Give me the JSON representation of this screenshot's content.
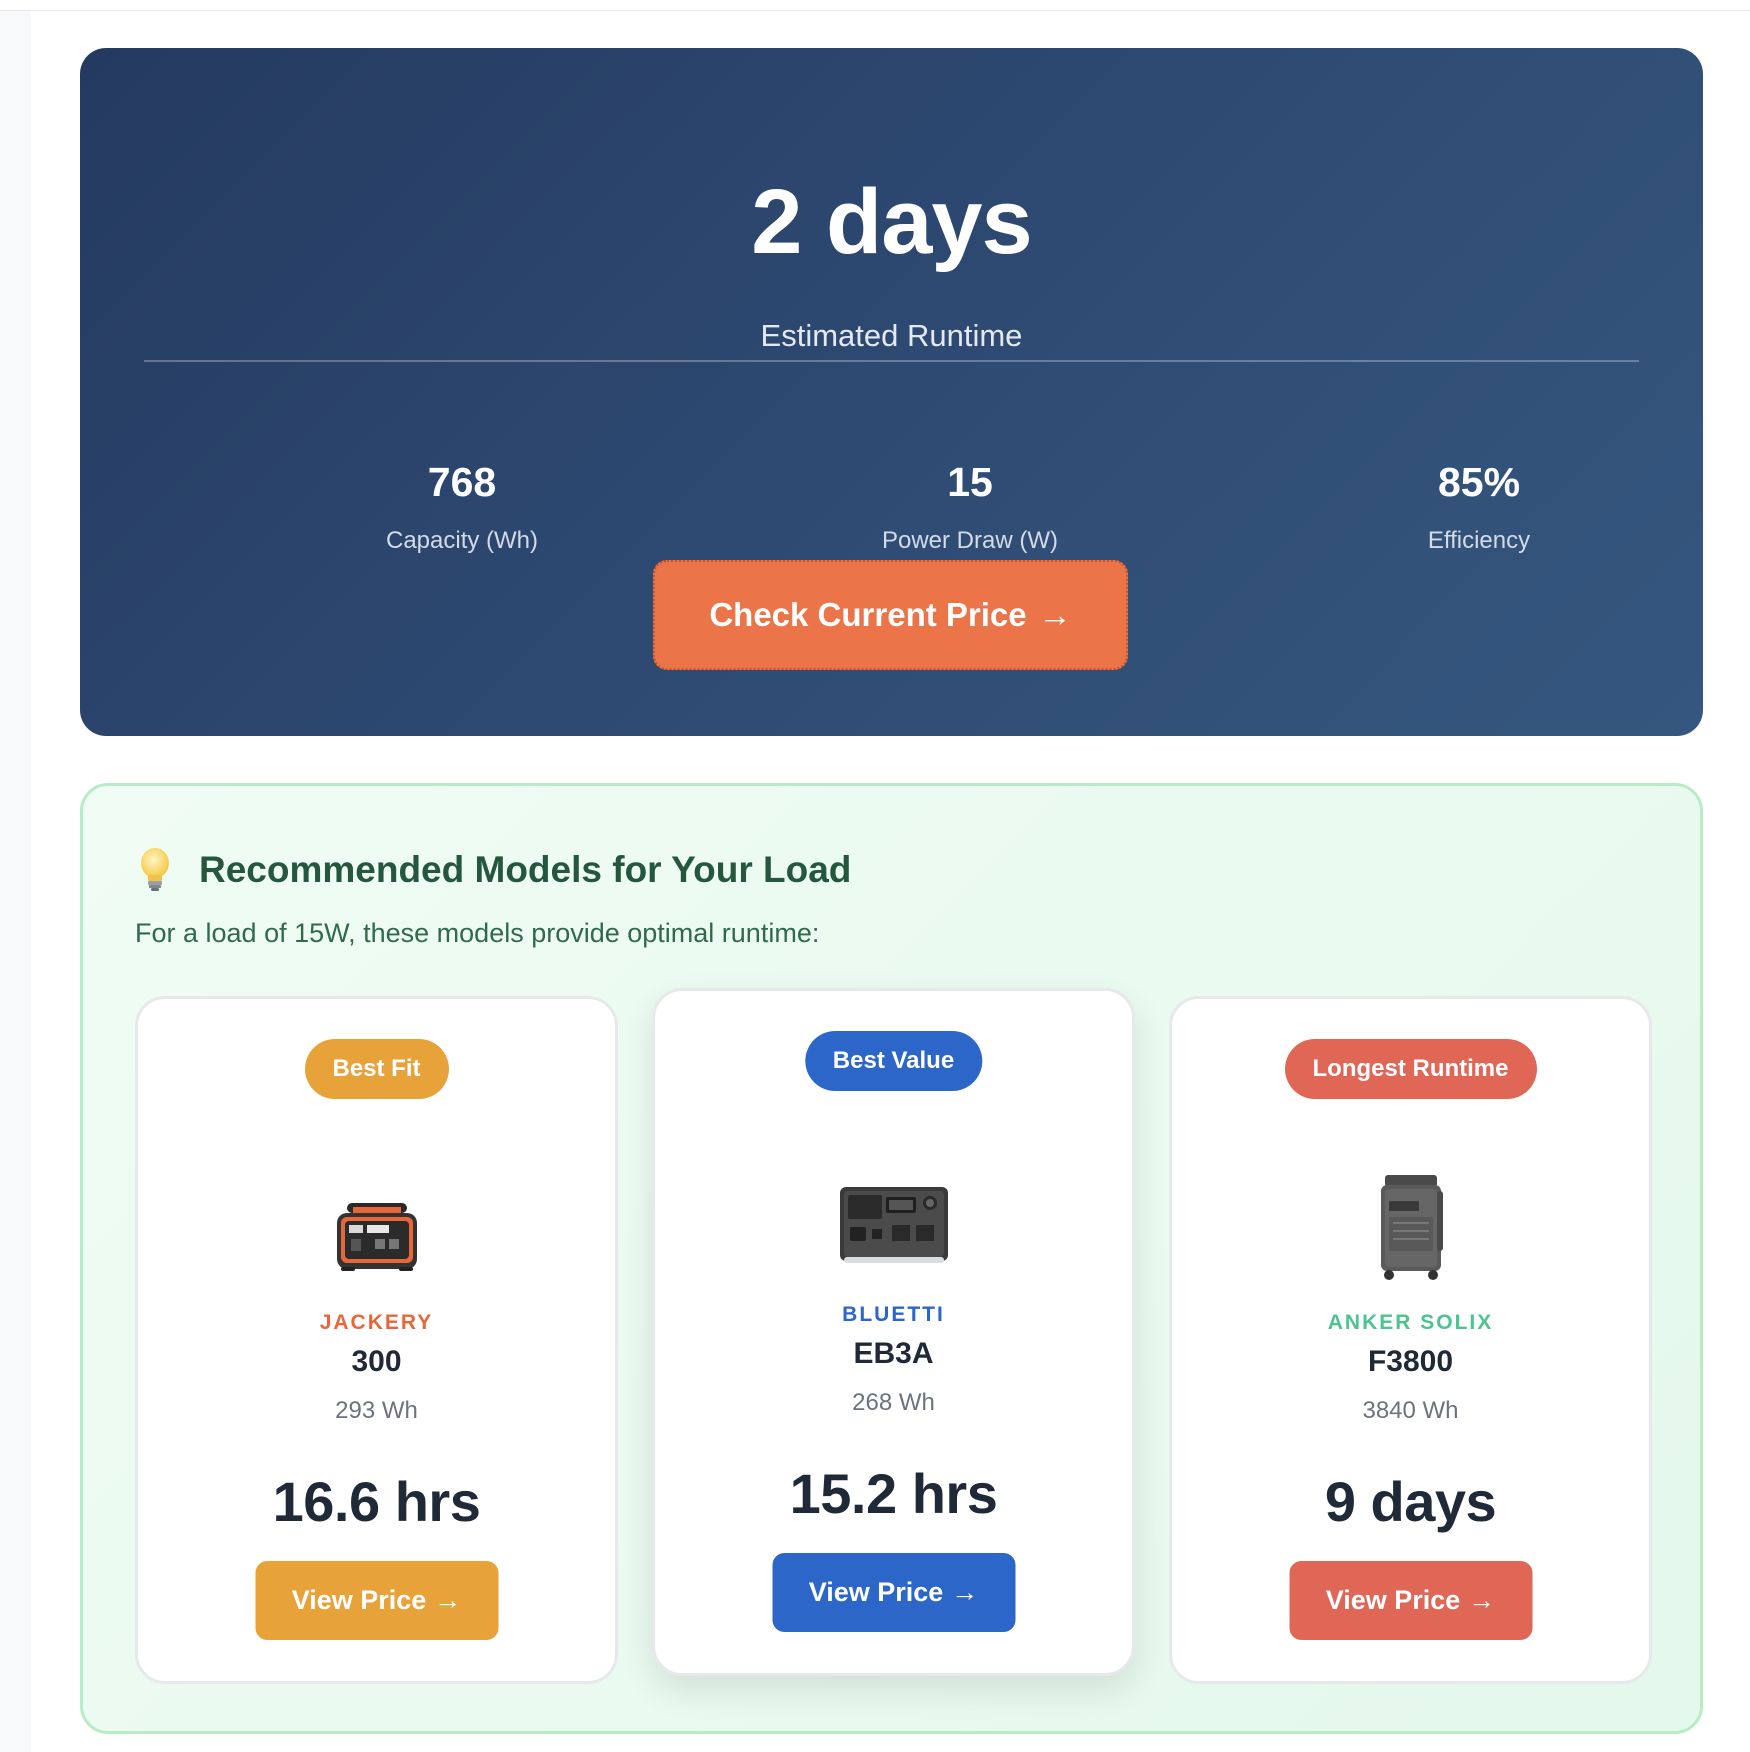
{
  "result": {
    "runtime_value": "2 days",
    "runtime_label": "Estimated Runtime",
    "stats": [
      {
        "value": "768",
        "label": "Capacity (Wh)"
      },
      {
        "value": "15",
        "label": "Power Draw (W)"
      },
      {
        "value": "85%",
        "label": "Efficiency"
      }
    ],
    "cta_label": "Check Current Price",
    "cta_arrow": "→",
    "cta_color": "#ec7449"
  },
  "recommendations": {
    "icon": "lightbulb-icon",
    "title": "Recommended Models for Your Load",
    "subtitle": "For a load of 15W, these models provide optimal runtime:",
    "products": [
      {
        "badge": "Best Fit",
        "badge_color": "#e8a23a",
        "image_icon": "power-station-jackery-icon",
        "brand": "JACKERY",
        "brand_color": "#e8673a",
        "model": "300",
        "capacity": "293 Wh",
        "runtime": "16.6 hrs",
        "button_label": "View Price",
        "button_arrow": "→",
        "button_color": "#e8a23a"
      },
      {
        "badge": "Best Value",
        "badge_color": "#2c66c9",
        "image_icon": "power-station-bluetti-icon",
        "brand": "BLUETTI",
        "brand_color": "#2c66c9",
        "model": "EB3A",
        "capacity": "268 Wh",
        "runtime": "15.2 hrs",
        "button_label": "View Price",
        "button_arrow": "→",
        "button_color": "#2c66c9"
      },
      {
        "badge": "Longest Runtime",
        "badge_color": "#e06656",
        "image_icon": "power-station-anker-icon",
        "brand": "ANKER SOLIX",
        "brand_color": "#4cc48f",
        "model": "F3800",
        "capacity": "3840 Wh",
        "runtime": "9 days",
        "button_label": "View Price",
        "button_arrow": "→",
        "button_color": "#e06656"
      }
    ]
  }
}
